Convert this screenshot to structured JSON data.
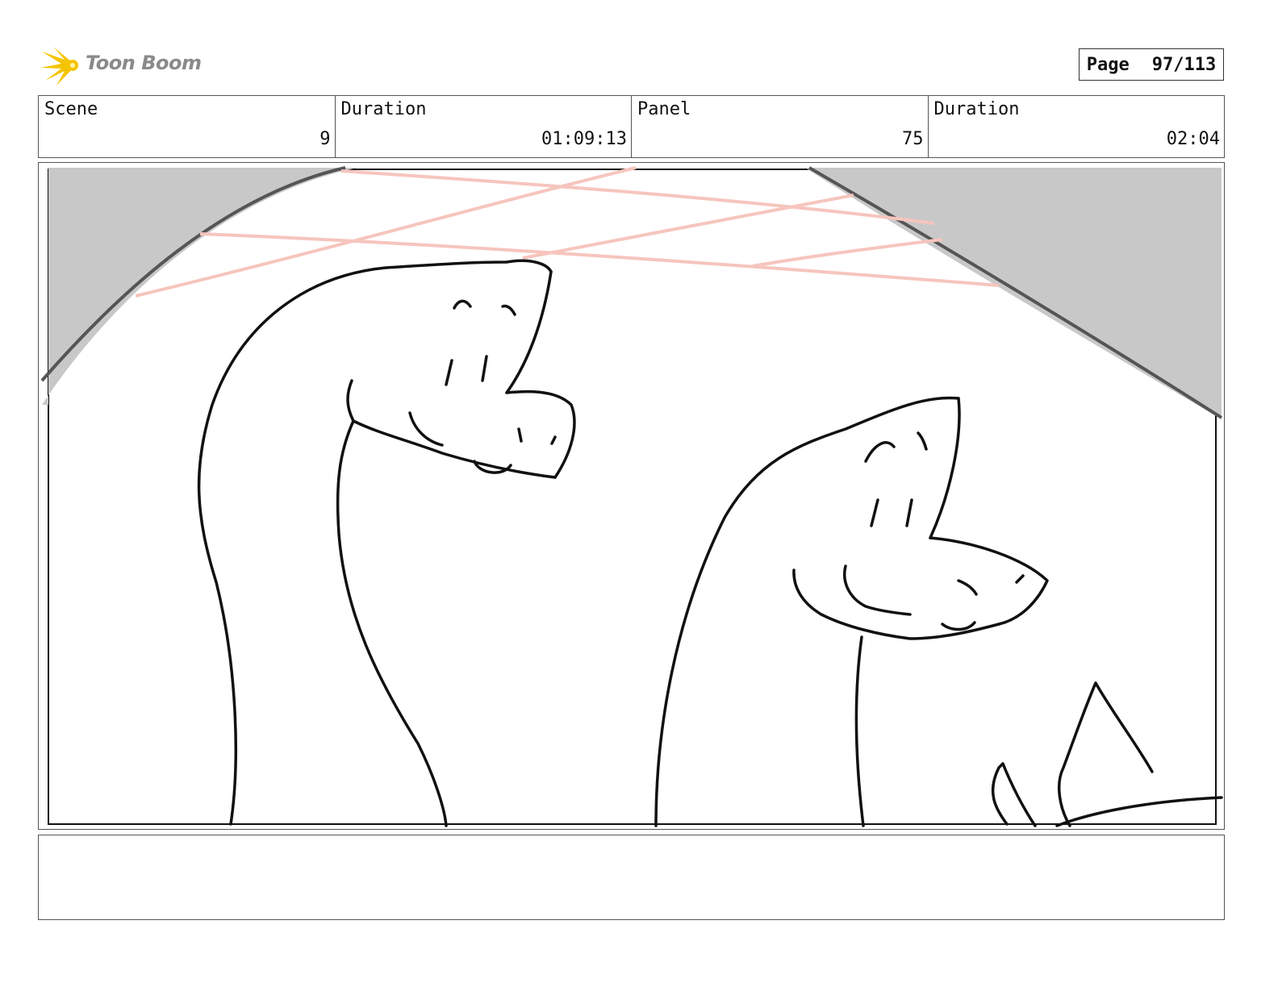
{
  "header": {
    "logo_text": "Toon Boom",
    "page_label": "Page",
    "page_value": "97/113"
  },
  "info": {
    "scene_label": "Scene",
    "scene_value": "9",
    "scene_duration_label": "Duration",
    "scene_duration_value": "01:09:13",
    "panel_label": "Panel",
    "panel_value": "75",
    "panel_duration_label": "Duration",
    "panel_duration_value": "02:04"
  },
  "panel_art": {
    "icon": "sketch-two-dinosaurs-smiling",
    "colors": {
      "ink": "#111111",
      "shadow": "#c8c8c8",
      "guide_lines": "#f6c5bd"
    }
  },
  "notes": {
    "text": ""
  },
  "colors": {
    "logo_star": "#f5c400",
    "logo_text": "#8a8a8a",
    "border": "#555555"
  }
}
